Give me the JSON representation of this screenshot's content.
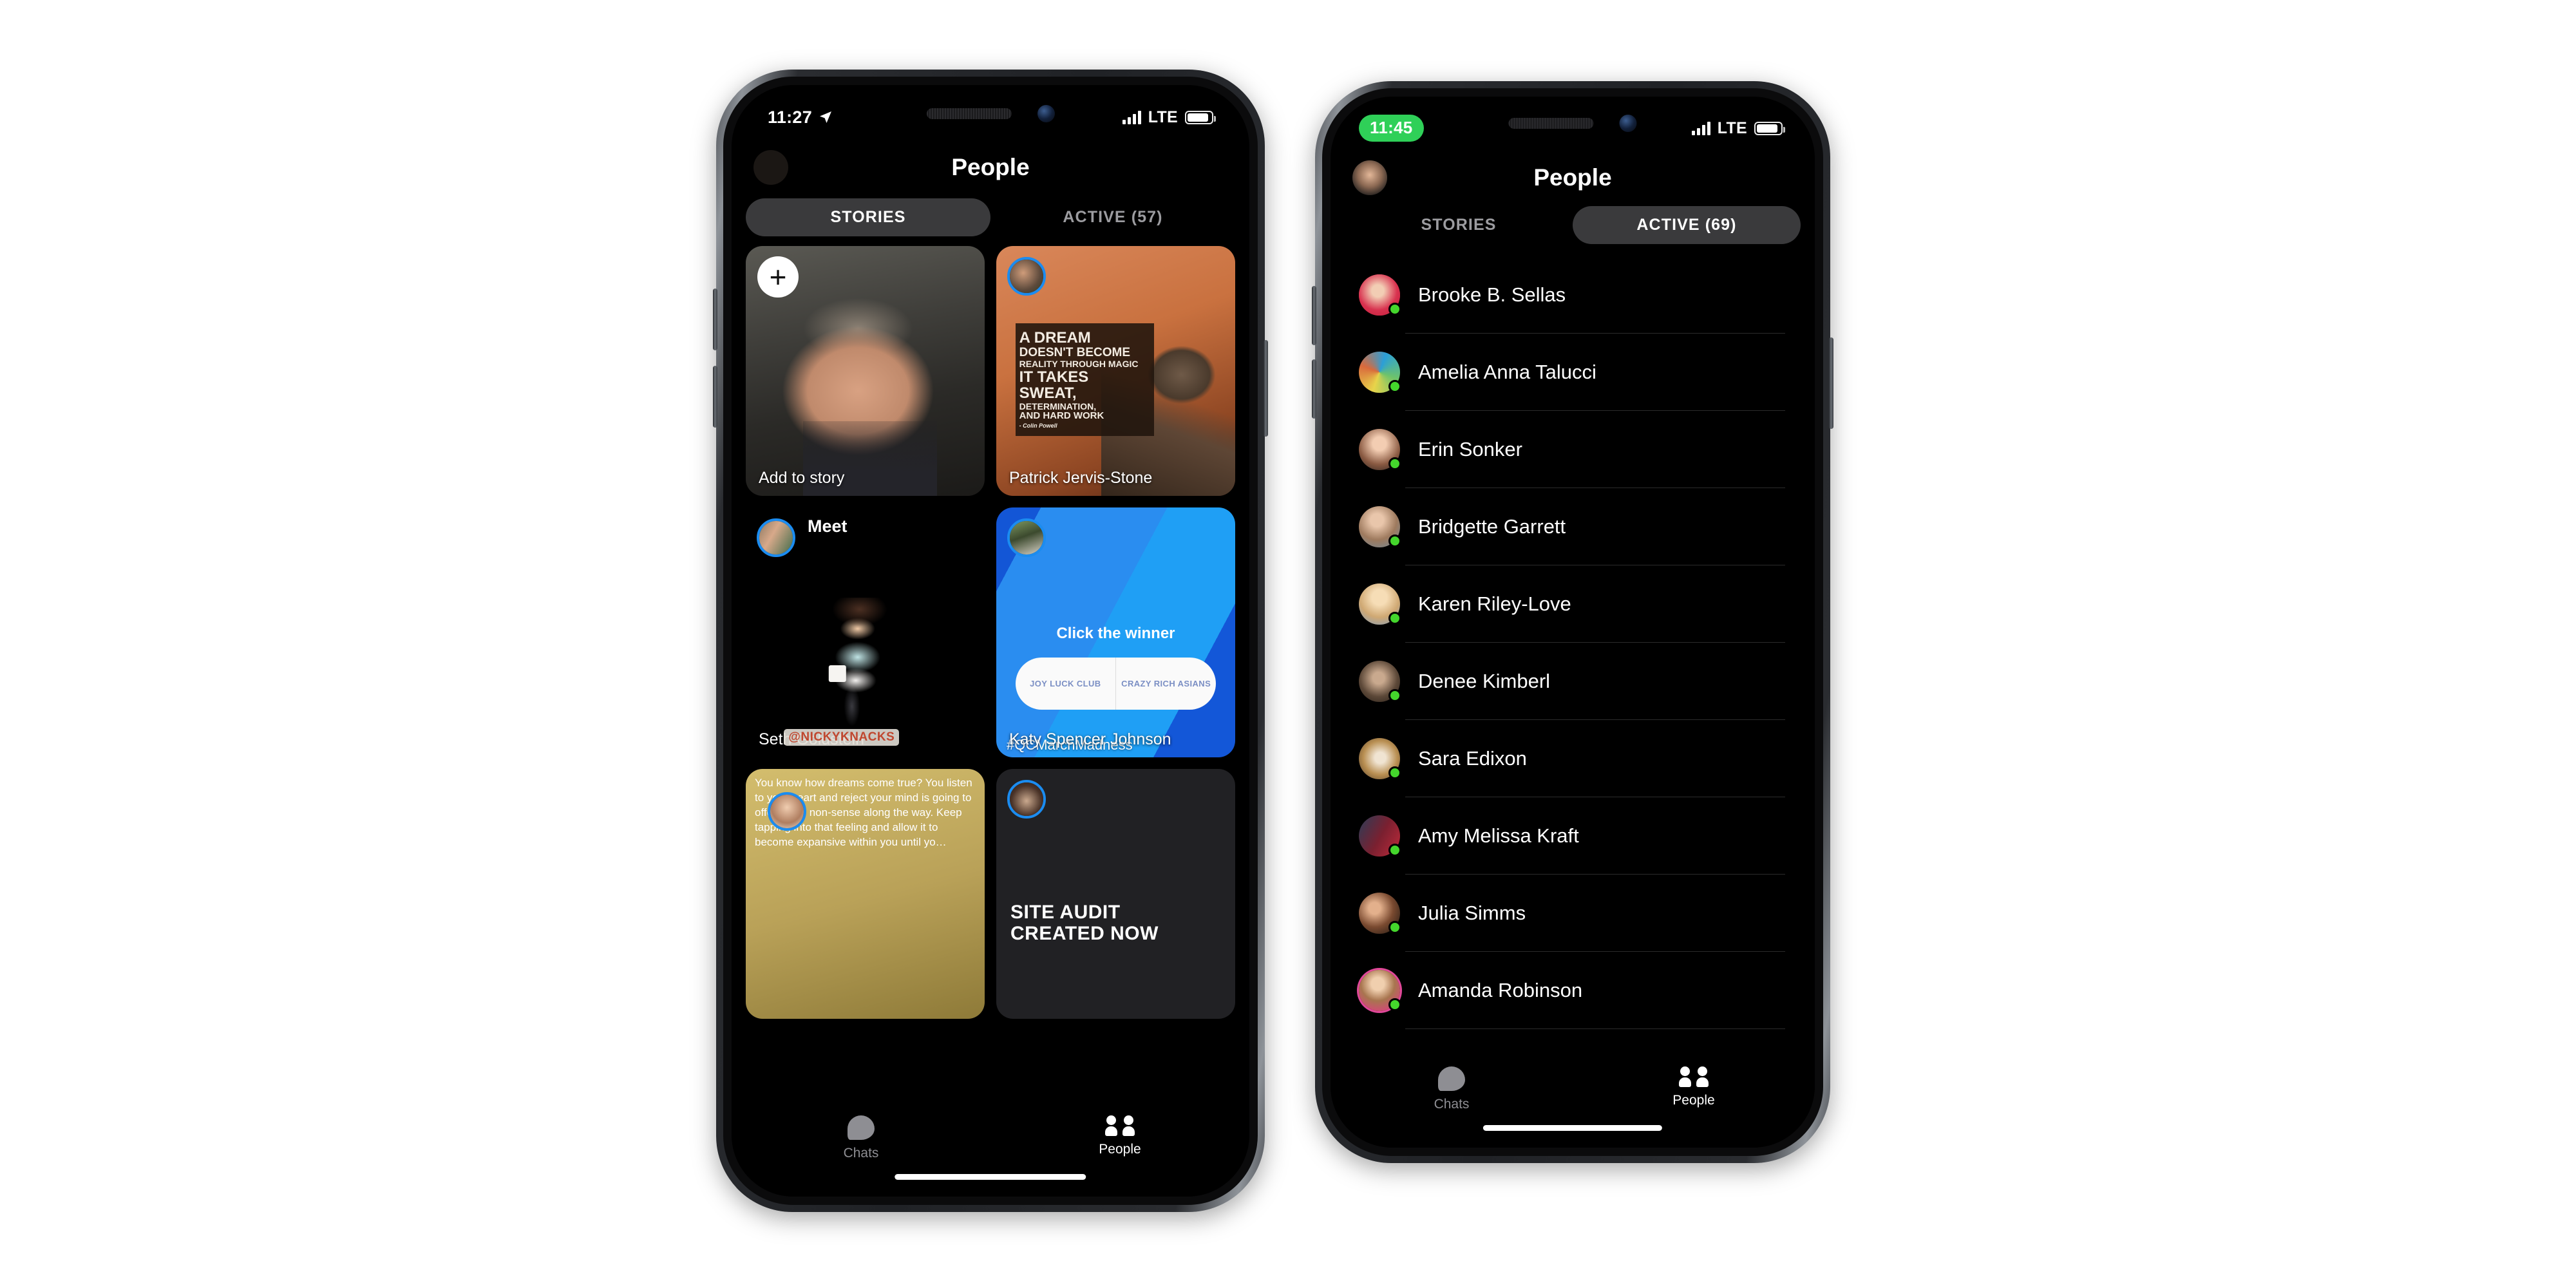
{
  "phones": [
    {
      "id": "left",
      "status_bar": {
        "time": "11:27",
        "location_icon": "location-arrow-icon",
        "carrier": "LTE",
        "signal_bars": 4,
        "battery_icon": "battery-icon",
        "time_is_pill": false
      },
      "header": {
        "title": "People",
        "avatar": "profile-avatar"
      },
      "tabs": [
        {
          "label": "STORIES",
          "selected": true
        },
        {
          "label": "ACTIVE (57)",
          "selected": false
        }
      ],
      "stories": [
        {
          "kind": "add",
          "caption": "Add to story",
          "badge": "plus-icon"
        },
        {
          "kind": "quote",
          "caption": "Patrick Jervis-Stone",
          "quote_lines": [
            "A DREAM",
            "DOESN'T BECOME",
            "REALITY THROUGH MAGIC",
            "IT TAKES",
            "SWEAT,",
            "DETERMINATION,",
            "AND HARD WORK"
          ],
          "quote_attribution": "- Colin Powell"
        },
        {
          "kind": "meet",
          "overlay_title": "Meet",
          "caption": "Seth Goldstein",
          "handle_tag": "@NICKYKNACKS"
        },
        {
          "kind": "poll",
          "poll_question": "Click the winner",
          "poll_options": [
            "JOY LUCK CLUB",
            "CRAZY RICH ASIANS"
          ],
          "caption": "Katy Spencer Johnson",
          "hashtag": "#QCMarchMadness"
        },
        {
          "kind": "text",
          "body": "You know how dreams come true? You listen to your heart and reject your mind is going to offer some non-sense along the way.\nKeep tapping into that feeling and allow it to become expansive within you until yo…"
        },
        {
          "kind": "audit",
          "title_lines": [
            "SITE AUDIT",
            "CREATED  NOW"
          ]
        }
      ],
      "tabbar": [
        {
          "label": "Chats",
          "icon": "chat-bubble-icon",
          "active": false
        },
        {
          "label": "People",
          "icon": "people-icon",
          "active": true
        }
      ]
    },
    {
      "id": "right",
      "status_bar": {
        "time": "11:45",
        "carrier": "LTE",
        "signal_bars": 4,
        "battery_icon": "battery-icon",
        "time_is_pill": true,
        "time_pill_color": "#2fd058"
      },
      "header": {
        "title": "People",
        "avatar": "profile-avatar"
      },
      "tabs": [
        {
          "label": "STORIES",
          "selected": false
        },
        {
          "label": "ACTIVE (69)",
          "selected": true
        }
      ],
      "people": [
        {
          "name": "Brooke B. Sellas",
          "online": true,
          "ring": "red"
        },
        {
          "name": "Amelia Anna Talucci",
          "online": true,
          "ring": "none"
        },
        {
          "name": "Erin Sonker",
          "online": true,
          "ring": "none"
        },
        {
          "name": "Bridgette Garrett",
          "online": true,
          "ring": "none"
        },
        {
          "name": "Karen Riley-Love",
          "online": true,
          "ring": "none"
        },
        {
          "name": "Denee Kimberl",
          "online": true,
          "ring": "none"
        },
        {
          "name": "Sara Edixon",
          "online": true,
          "ring": "none"
        },
        {
          "name": "Amy Melissa Kraft",
          "online": true,
          "ring": "none"
        },
        {
          "name": "Julia Simms",
          "online": true,
          "ring": "none"
        },
        {
          "name": "Amanda Robinson",
          "online": true,
          "ring": "pink"
        }
      ],
      "tabbar": [
        {
          "label": "Chats",
          "icon": "chat-bubble-icon",
          "active": false
        },
        {
          "label": "People",
          "icon": "people-icon",
          "active": true
        }
      ]
    }
  ],
  "colors": {
    "page_background": "#ffffff",
    "screen_background": "#000000",
    "online_dot": "#44d62c",
    "tab_selected_bg": "#3a3a3c",
    "tab_inactive_text": "#9c9ca0",
    "recording_pill": "#2fd058",
    "story_ring_blue": "#1b8cf0",
    "story_ring_pink": "#e2489a",
    "poll_blue": "#2a8df0"
  }
}
